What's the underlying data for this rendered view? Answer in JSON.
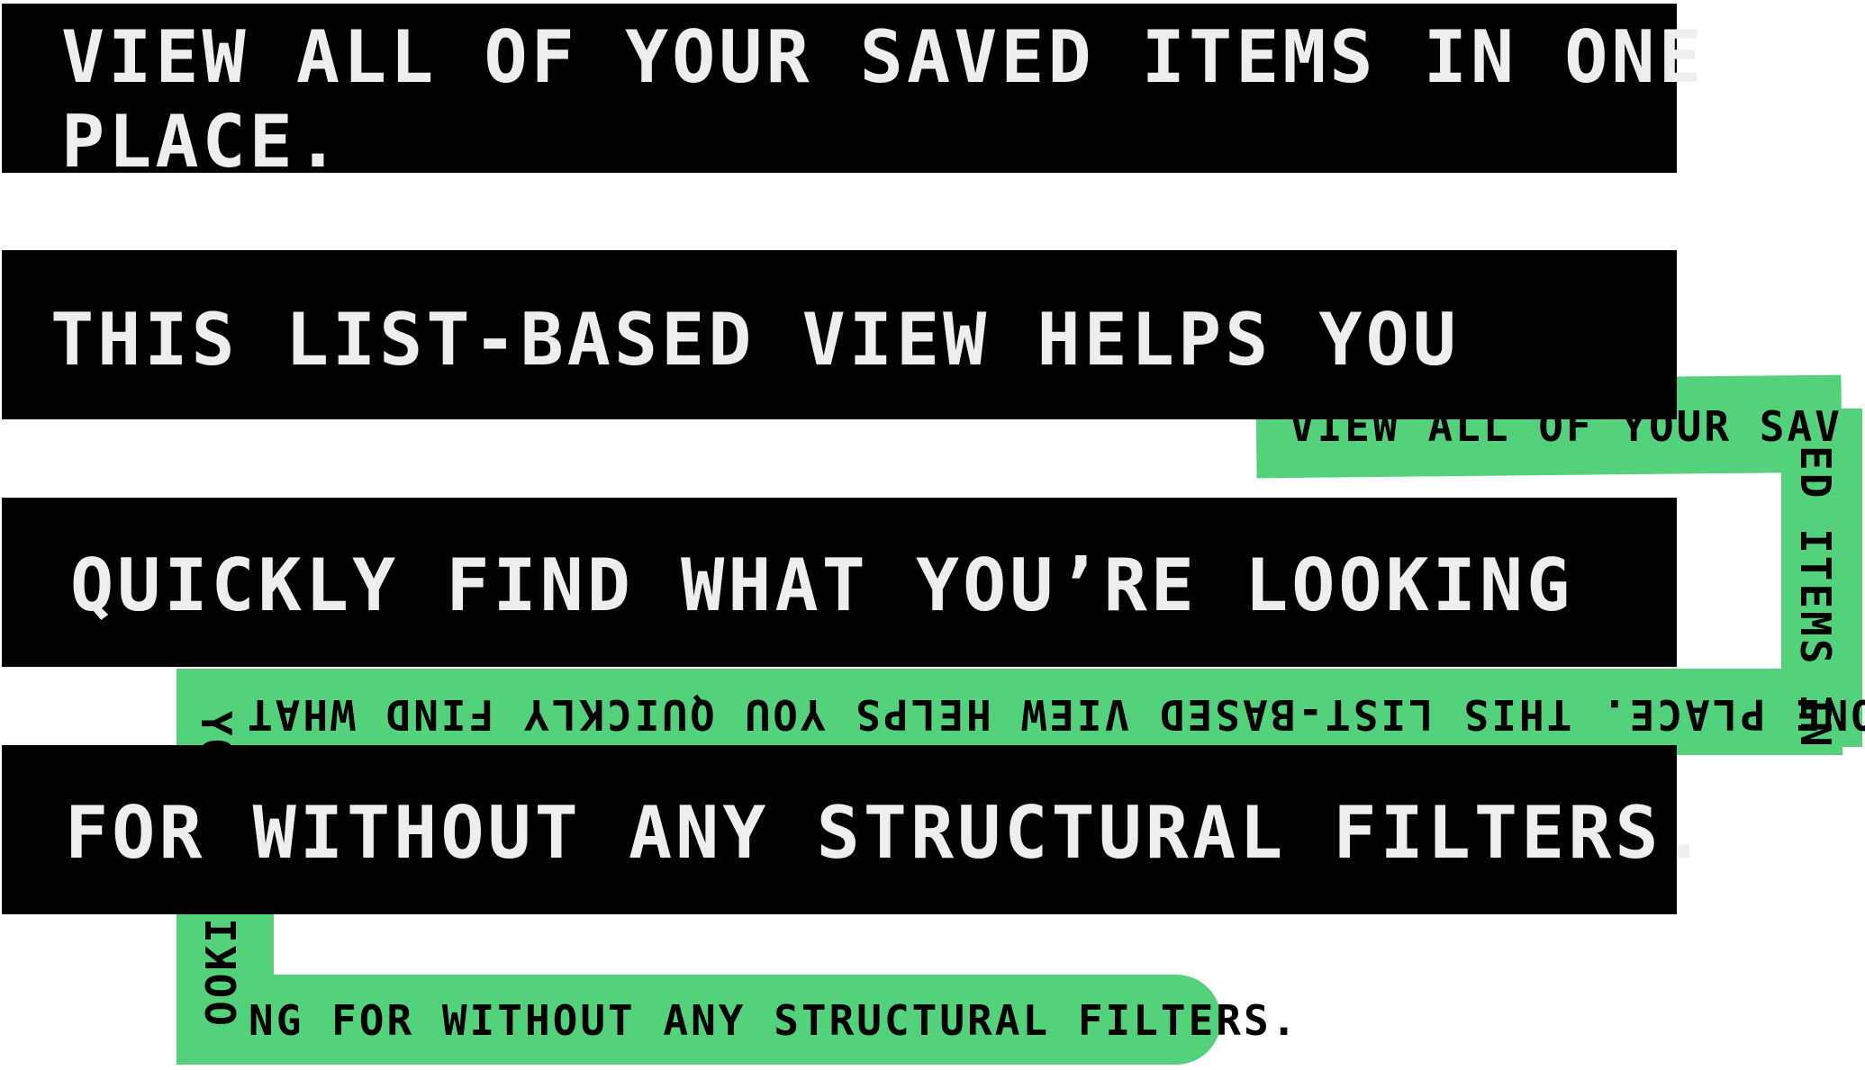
{
  "bars": [
    {
      "line1": "VIEW ALL OF YOUR SAVED ITEMS IN ONE",
      "line2": "PLACE."
    },
    {
      "text": "THIS LIST-BASED VIEW HELPS YOU"
    },
    {
      "text": "QUICKLY FIND WHAT  YOU’RE LOOKING"
    },
    {
      "text": "FOR WITHOUT ANY STRUCTURAL FILTERS."
    }
  ],
  "ribbon": {
    "top": "VIEW ALL OF YOUR SAV",
    "right": "ED ITEMS IN",
    "middle": "ONE PLACE. THIS LIST-BASED VIEW HELPS YOU QUICKLY FIND WHAT",
    "left_upper": "YO",
    "left_lower": "OOKI",
    "bottom": "NG FOR WITHOUT ANY STRUCTURAL FILTERS."
  },
  "colors": {
    "bar": "#000000",
    "bar_text": "#eeeeee",
    "ribbon": "#53d27b",
    "ribbon_text": "#000000"
  }
}
